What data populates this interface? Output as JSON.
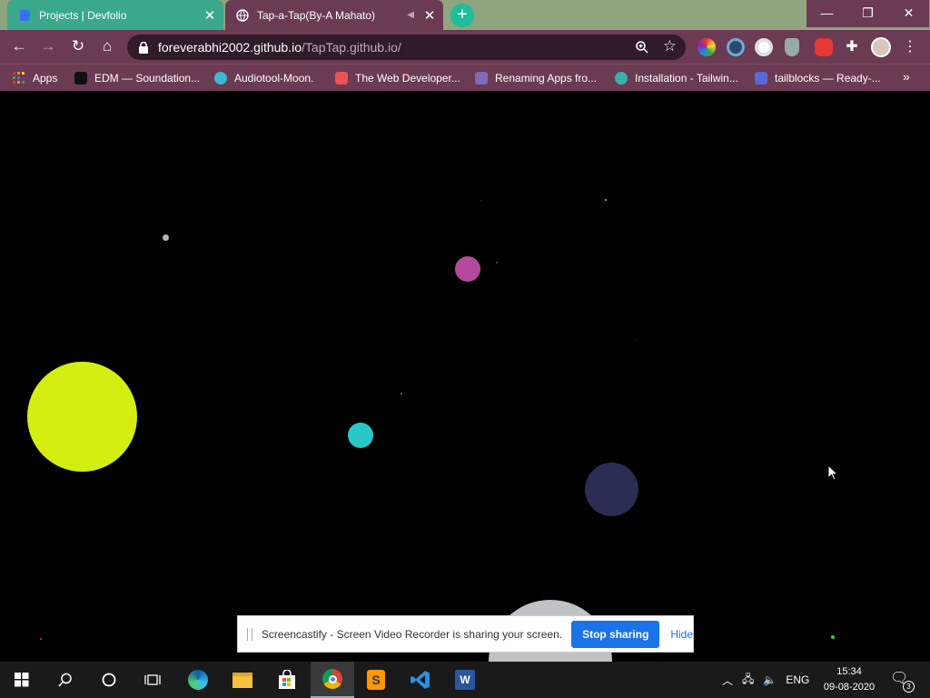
{
  "tabs": [
    {
      "title": "Projects | Devfolio",
      "icon": "devfolio-icon",
      "active": false
    },
    {
      "title": "Tap-a-Tap(By-A Mahato)",
      "icon": "globe-icon",
      "active": true
    }
  ],
  "address_bar": {
    "host": "foreverabhi2002.github.io",
    "path": "/TapTap.github.io/"
  },
  "bookmarks": [
    {
      "label": "Apps",
      "icon": "apps-grid-icon"
    },
    {
      "label": "EDM — Soundation...",
      "icon": "soundation-icon"
    },
    {
      "label": "Audiotool-Moon.",
      "icon": "audiotool-icon"
    },
    {
      "label": "The Web Developer...",
      "icon": "udemy-icon"
    },
    {
      "label": "Renaming Apps fro...",
      "icon": "heroku-icon"
    },
    {
      "label": "Installation - Tailwin...",
      "icon": "tailwind-icon"
    },
    {
      "label": "tailblocks — Ready-...",
      "icon": "tailblocks-icon"
    }
  ],
  "game": {
    "background": "#000000",
    "circle_colors": [
      "#d4ee12",
      "#b5499b",
      "#29c7c7",
      "#2b2d55",
      "#aeb5bb",
      "#bfc3c6"
    ]
  },
  "share_bar": {
    "message": "Screencastify - Screen Video Recorder is sharing your screen.",
    "stop_label": "Stop sharing",
    "hide_label": "Hide"
  },
  "taskbar": {
    "pinned": [
      "edge-icon",
      "file-explorer-icon",
      "store-icon",
      "chrome-icon",
      "sublime-text-icon",
      "vscode-icon",
      "word-icon"
    ],
    "language": "ENG",
    "time": "15:34",
    "date": "09-08-2020",
    "notification_count": "3"
  }
}
